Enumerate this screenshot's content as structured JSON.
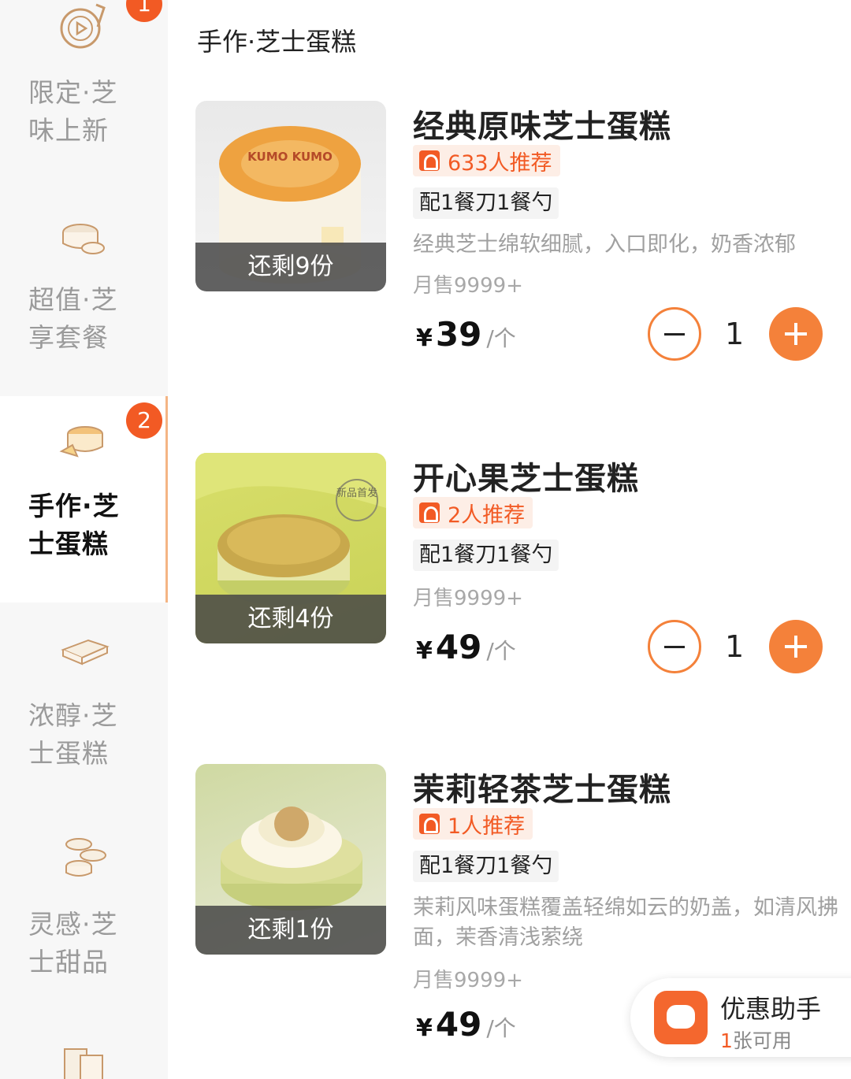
{
  "sidebar": {
    "items": [
      {
        "label": "限定·芝味上新",
        "line1": "限定·芝",
        "line2": "味上新",
        "badge": "1",
        "icon": "record-player-icon"
      },
      {
        "label": "超值·芝享套餐",
        "line1": "超值·芝",
        "line2": "享套餐",
        "icon": "cake-box-icon"
      },
      {
        "label": "手作·芝士蛋糕",
        "line1": "手作·芝",
        "line2": "士蛋糕",
        "badge": "2",
        "icon": "cheesecake-icon",
        "active": true
      },
      {
        "label": "浓醇·芝士蛋糕",
        "line1": "浓醇·芝",
        "line2": "士蛋糕",
        "icon": "cheese-bar-icon"
      },
      {
        "label": "灵感·芝士甜品",
        "line1": "灵感·芝",
        "line2": "士甜品",
        "icon": "dessert-stack-icon"
      },
      {
        "icon": "bag-icon"
      }
    ]
  },
  "section": {
    "title": "手作·芝士蛋糕"
  },
  "products": [
    {
      "name": "经典原味芝士蛋糕",
      "recommend": "633人推荐",
      "utensils": "配1餐刀1餐勺",
      "description": "经典芝士绵软细腻，入口即化，奶香浓郁",
      "sales": "月售9999+",
      "currency": "¥",
      "price": "39",
      "unit": "/个",
      "quantity": "1",
      "stock": "还剩9份",
      "cake_brand": "KUMO KUMO"
    },
    {
      "name": "开心果芝士蛋糕",
      "recommend": "2人推荐",
      "utensils": "配1餐刀1餐勺",
      "sales": "月售9999+",
      "currency": "¥",
      "price": "49",
      "unit": "/个",
      "quantity": "1",
      "stock": "还剩4份",
      "stamp": "新品首发"
    },
    {
      "name": "茉莉轻茶芝士蛋糕",
      "recommend": "1人推荐",
      "utensils": "配1餐刀1餐勺",
      "description": "茉莉风味蛋糕覆盖轻绵如云的奶盖，如清风拂面，茉香清浅萦绕",
      "sales": "月售9999+",
      "currency": "¥",
      "price": "49",
      "unit": "/个",
      "stock": "还剩1份"
    }
  ],
  "coupon_helper": {
    "title": "优惠助手",
    "count": "1",
    "suffix": "张可用"
  },
  "colors": {
    "accent": "#f4813a",
    "badge": "#f25a24",
    "recommend_bg": "#fdeee6"
  }
}
